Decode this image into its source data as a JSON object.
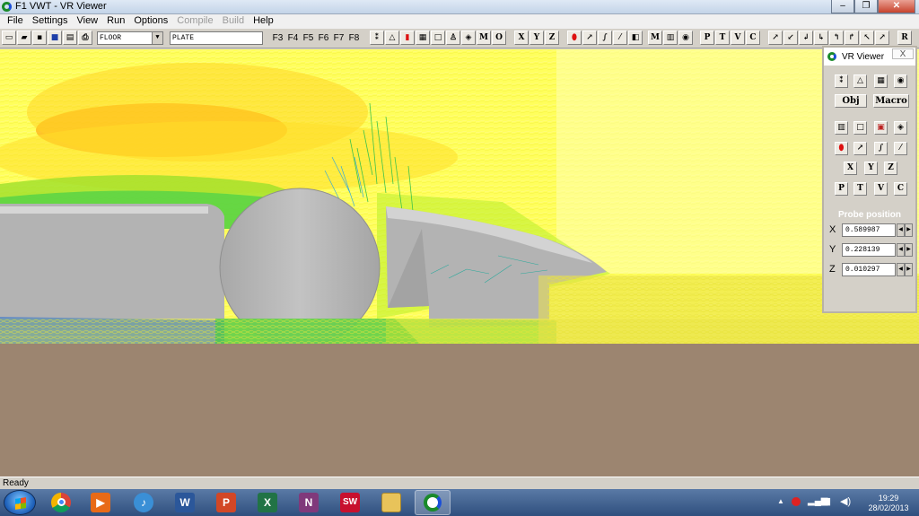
{
  "window": {
    "title": "F1 VWT - VR Viewer"
  },
  "menu": [
    "File",
    "Settings",
    "View",
    "Run",
    "Options",
    "Compile",
    "Build",
    "Help"
  ],
  "menu_disabled": [
    "Compile",
    "Build"
  ],
  "toolbar": {
    "combo1_value": "FLOOR",
    "combo2_value": "PLATE",
    "fkeys": [
      "F3",
      "F4",
      "F5",
      "F6",
      "F7",
      "F8"
    ],
    "letters1": [
      "M",
      "O"
    ],
    "axes": [
      "X",
      "Y",
      "Z"
    ],
    "letters2": [
      "M"
    ],
    "letters3": [
      "P",
      "T",
      "V",
      "C"
    ],
    "letters4": [
      "R"
    ]
  },
  "panel": {
    "title": "VR Viewer",
    "close_label": "X",
    "obj_label": "Obj",
    "macro_label": "Macro",
    "axis_buttons": [
      "X",
      "Y",
      "Z"
    ],
    "view_buttons": [
      "P",
      "T",
      "V",
      "C"
    ],
    "probe_title": "Probe position",
    "probe": [
      {
        "label": "X",
        "value": "0.589987"
      },
      {
        "label": "Y",
        "value": "0.228139"
      },
      {
        "label": "Z",
        "value": "0.010297"
      }
    ]
  },
  "status": {
    "text": "Ready"
  },
  "taskbar": {
    "apps": [
      "chrome-icon",
      "media-player-icon",
      "itunes-icon",
      "word-icon",
      "powerpoint-icon",
      "excel-icon",
      "onenote-icon",
      "solidworks-icon",
      "explorer-icon",
      "vr-viewer-icon"
    ],
    "time": "19:29",
    "date": "28/02/2013"
  },
  "colors": {
    "flow_field": "#ffff66",
    "ground": "#9c8570",
    "geometry": "#b9b9b9"
  }
}
